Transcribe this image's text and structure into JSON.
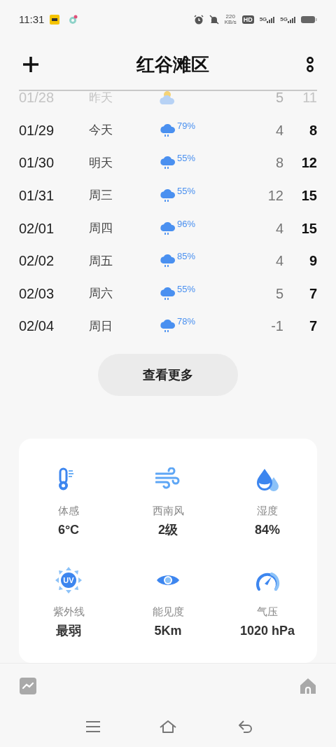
{
  "status_bar": {
    "time": "11:31",
    "speed": "220",
    "speed_unit": "KB/s",
    "hd": "HD",
    "sim_labels": [
      "5G",
      "5G"
    ]
  },
  "header": {
    "title": "红谷滩区"
  },
  "forecast": [
    {
      "date": "01/28",
      "day": "昨天",
      "kind": "cloudy",
      "low": "5",
      "high": "11",
      "past": true
    },
    {
      "date": "01/29",
      "day": "今天",
      "kind": "rain",
      "chance": "79%",
      "low": "4",
      "high": "8",
      "past": false
    },
    {
      "date": "01/30",
      "day": "明天",
      "kind": "rain",
      "chance": "55%",
      "low": "8",
      "high": "12",
      "past": false
    },
    {
      "date": "01/31",
      "day": "周三",
      "kind": "rain",
      "chance": "55%",
      "low": "12",
      "high": "15",
      "past": false
    },
    {
      "date": "02/01",
      "day": "周四",
      "kind": "rain",
      "chance": "96%",
      "low": "4",
      "high": "15",
      "past": false
    },
    {
      "date": "02/02",
      "day": "周五",
      "kind": "rain",
      "chance": "85%",
      "low": "4",
      "high": "9",
      "past": false
    },
    {
      "date": "02/03",
      "day": "周六",
      "kind": "rain",
      "chance": "55%",
      "low": "5",
      "high": "7",
      "past": false
    },
    {
      "date": "02/04",
      "day": "周日",
      "kind": "rain",
      "chance": "78%",
      "low": "-1",
      "high": "7",
      "past": false
    }
  ],
  "more_button": "查看更多",
  "details": [
    {
      "kind": "feels",
      "label": "体感",
      "value": "6°C"
    },
    {
      "kind": "wind",
      "label": "西南风",
      "value": "2级"
    },
    {
      "kind": "humidity",
      "label": "湿度",
      "value": "84%"
    },
    {
      "kind": "uv",
      "label": "紫外线",
      "value": "最弱",
      "badge": "UV"
    },
    {
      "kind": "visibility",
      "label": "能见度",
      "value": "5Km"
    },
    {
      "kind": "pressure",
      "label": "气压",
      "value": "1020 hPa"
    }
  ]
}
